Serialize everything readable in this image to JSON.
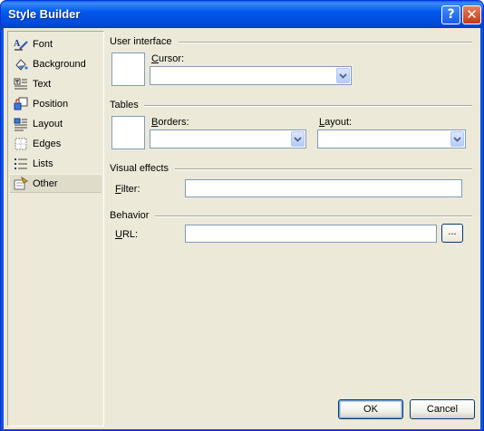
{
  "window": {
    "title": "Style Builder",
    "help_glyph": "?",
    "close_glyph": "✕"
  },
  "sidebar": {
    "items": [
      {
        "label": "Font",
        "icon": "font-icon"
      },
      {
        "label": "Background",
        "icon": "background-icon"
      },
      {
        "label": "Text",
        "icon": "text-icon"
      },
      {
        "label": "Position",
        "icon": "position-icon"
      },
      {
        "label": "Layout",
        "icon": "layout-icon"
      },
      {
        "label": "Edges",
        "icon": "edges-icon"
      },
      {
        "label": "Lists",
        "icon": "lists-icon"
      },
      {
        "label": "Other",
        "icon": "other-icon",
        "selected": true
      }
    ]
  },
  "user_interface": {
    "heading": "User interface",
    "cursor_label_key": "C",
    "cursor_label_rest": "ursor:",
    "cursor_value": ""
  },
  "tables": {
    "heading": "Tables",
    "borders_label_key": "B",
    "borders_label_rest": "orders:",
    "borders_value": "",
    "layout_label_key": "L",
    "layout_label_rest": "ayout:",
    "layout_value": ""
  },
  "visual_effects": {
    "heading": "Visual effects",
    "filter_label_key": "F",
    "filter_label_rest": "ilter:",
    "filter_value": ""
  },
  "behavior": {
    "heading": "Behavior",
    "url_label_key": "U",
    "url_label_rest": "RL:",
    "url_value": "",
    "browse_label": "..."
  },
  "footer": {
    "ok_label": "OK",
    "cancel_label": "Cancel"
  },
  "colors": {
    "title_bar": "#0058ee",
    "dialog_bg": "#ece9d8",
    "field_border": "#7f9db9"
  }
}
